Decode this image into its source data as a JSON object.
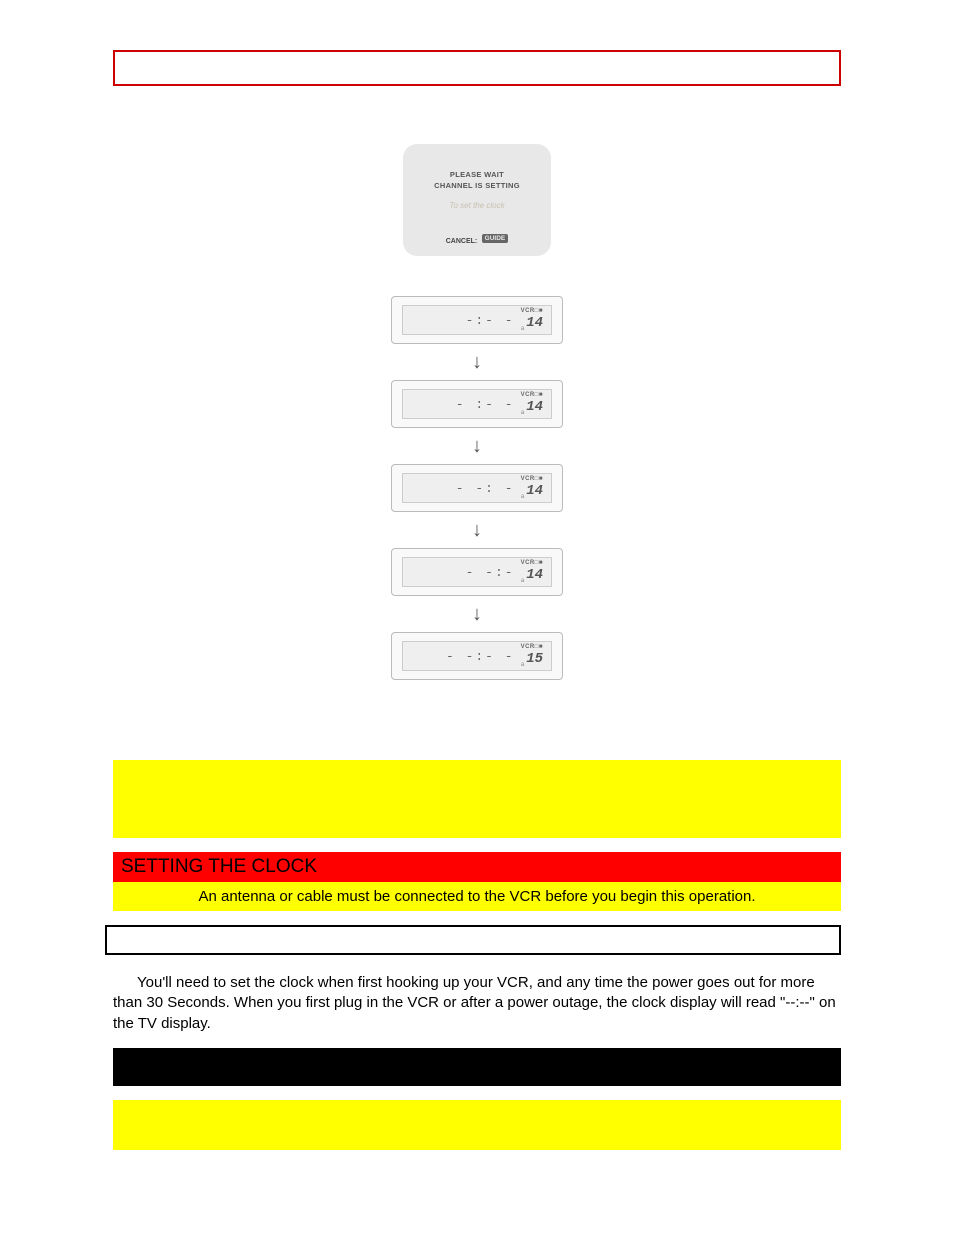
{
  "tv_screen": {
    "line1": "PLEASE WAIT",
    "line2": "CHANNEL IS SETTING",
    "faded": "To set the clock",
    "cancel_label": "CANCEL:",
    "guide_label": "GUIDE"
  },
  "lcd": {
    "vcr_label": "VCR",
    "indicator": "□■",
    "sub": "a",
    "rows": [
      {
        "time": "-:- -",
        "num": "14"
      },
      {
        "time": "- :- -",
        "num": "14"
      },
      {
        "time": "- -: -",
        "num": "14"
      },
      {
        "time": "- -:-",
        "num": "14"
      },
      {
        "time": "- -:- -",
        "num": "15"
      }
    ]
  },
  "section_header": "SETTING THE CLOCK",
  "antenna_note": "An antenna or cable must be connected to the VCR before you begin this operation.",
  "body_paragraph": "You'll need to set the clock when first hooking up your VCR, and any time the power goes out for more than 30 Seconds. When you first plug in the VCR or after a power outage, the clock display will read \"--:--\" on the TV display."
}
